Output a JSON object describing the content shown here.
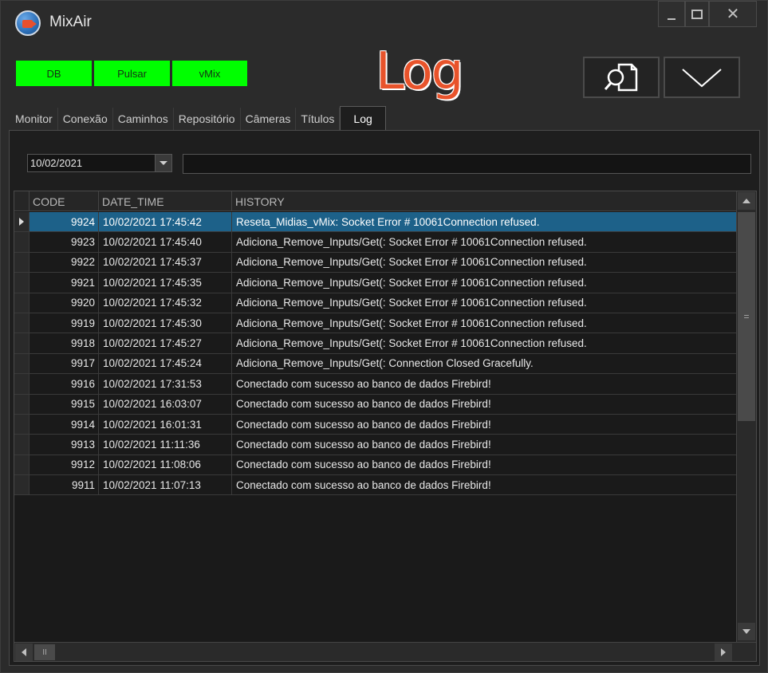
{
  "window": {
    "title": "MixAir",
    "icon": "camera-app-icon"
  },
  "status_buttons": [
    {
      "label": "DB",
      "color": "#00ff00"
    },
    {
      "label": "Pulsar",
      "color": "#00ff00"
    },
    {
      "label": "vMix",
      "color": "#00ff00"
    }
  ],
  "header": {
    "logo_text": "Log",
    "logo_color": "#e8532b",
    "icons": [
      "document-search-icon",
      "chevron-down-icon"
    ]
  },
  "tabs": [
    {
      "label": "Monitor"
    },
    {
      "label": "Conexão"
    },
    {
      "label": "Caminhos"
    },
    {
      "label": "Repositório"
    },
    {
      "label": "Câmeras"
    },
    {
      "label": "Títulos"
    },
    {
      "label": "Log",
      "active": true
    }
  ],
  "filter": {
    "date_value": "10/02/2021",
    "search_value": ""
  },
  "grid": {
    "columns": [
      "CODE",
      "DATE_TIME",
      "HISTORY"
    ],
    "selection_color": "#1d6189",
    "rows": [
      {
        "code": "9924",
        "date_time": "10/02/2021 17:45:42",
        "history": "Reseta_Midias_vMix: Socket Error # 10061Connection refused.",
        "selected": true
      },
      {
        "code": "9923",
        "date_time": "10/02/2021 17:45:40",
        "history": "Adiciona_Remove_Inputs/Get(: Socket Error # 10061Connection refused."
      },
      {
        "code": "9922",
        "date_time": "10/02/2021 17:45:37",
        "history": "Adiciona_Remove_Inputs/Get(: Socket Error # 10061Connection refused."
      },
      {
        "code": "9921",
        "date_time": "10/02/2021 17:45:35",
        "history": "Adiciona_Remove_Inputs/Get(: Socket Error # 10061Connection refused."
      },
      {
        "code": "9920",
        "date_time": "10/02/2021 17:45:32",
        "history": "Adiciona_Remove_Inputs/Get(: Socket Error # 10061Connection refused."
      },
      {
        "code": "9919",
        "date_time": "10/02/2021 17:45:30",
        "history": "Adiciona_Remove_Inputs/Get(: Socket Error # 10061Connection refused."
      },
      {
        "code": "9918",
        "date_time": "10/02/2021 17:45:27",
        "history": "Adiciona_Remove_Inputs/Get(: Socket Error # 10061Connection refused."
      },
      {
        "code": "9917",
        "date_time": "10/02/2021 17:45:24",
        "history": "Adiciona_Remove_Inputs/Get(: Connection Closed Gracefully."
      },
      {
        "code": "9916",
        "date_time": "10/02/2021 17:31:53",
        "history": "Conectado com sucesso ao banco de dados Firebird!"
      },
      {
        "code": "9915",
        "date_time": "10/02/2021 16:03:07",
        "history": "Conectado com sucesso ao banco de dados Firebird!"
      },
      {
        "code": "9914",
        "date_time": "10/02/2021 16:01:31",
        "history": "Conectado com sucesso ao banco de dados Firebird!"
      },
      {
        "code": "9913",
        "date_time": "10/02/2021 11:11:36",
        "history": "Conectado com sucesso ao banco de dados Firebird!"
      },
      {
        "code": "9912",
        "date_time": "10/02/2021 11:08:06",
        "history": "Conectado com sucesso ao banco de dados Firebird!"
      },
      {
        "code": "9911",
        "date_time": "10/02/2021 11:07:13",
        "history": "Conectado com sucesso ao banco de dados Firebird!"
      }
    ]
  }
}
